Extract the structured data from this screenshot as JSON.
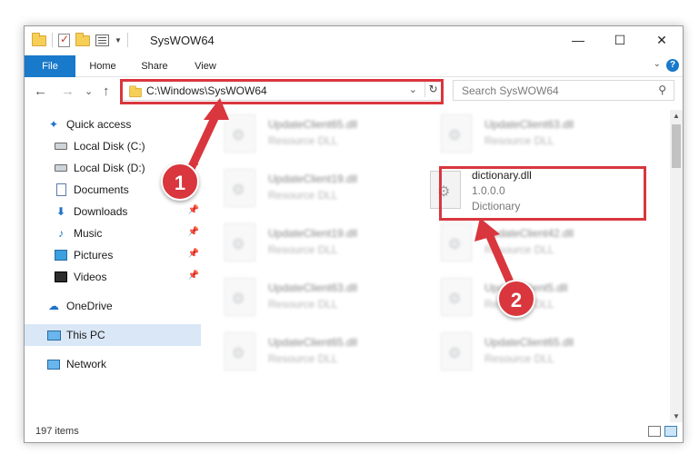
{
  "window": {
    "title": "SysWOW64"
  },
  "window_controls": {
    "minimize": "—",
    "maximize": "☐",
    "close": "✕"
  },
  "ribbon": {
    "tabs": [
      "File",
      "Home",
      "Share",
      "View"
    ],
    "help": "?"
  },
  "nav": {
    "back": "←",
    "forward": "→",
    "recent": "⌄",
    "up": "↑",
    "address_path": "C:\\Windows\\SysWOW64",
    "address_dropdown": "⌄",
    "refresh": "↻",
    "search_placeholder": "Search SysWOW64",
    "search_icon": "⚲"
  },
  "sidebar": {
    "items": [
      {
        "label": "Quick access",
        "icon": "star-icon",
        "pinned": false
      },
      {
        "label": "Local Disk (C:)",
        "icon": "drive-icon",
        "pinned": false
      },
      {
        "label": "Local Disk (D:)",
        "icon": "drive-icon",
        "pinned": true
      },
      {
        "label": "Documents",
        "icon": "documents-icon",
        "pinned": true
      },
      {
        "label": "Downloads",
        "icon": "downloads-icon",
        "pinned": true
      },
      {
        "label": "Music",
        "icon": "music-icon",
        "pinned": true
      },
      {
        "label": "Pictures",
        "icon": "pictures-icon",
        "pinned": true
      },
      {
        "label": "Videos",
        "icon": "videos-icon",
        "pinned": true
      },
      {
        "label": "OneDrive",
        "icon": "onedrive-icon",
        "pinned": false
      },
      {
        "label": "This PC",
        "icon": "this-pc-icon",
        "pinned": false,
        "selected": true
      },
      {
        "label": "Network",
        "icon": "network-icon",
        "pinned": false
      }
    ]
  },
  "files": [
    {
      "name": "UpdateClient65.dll",
      "desc": "Resource DLL",
      "col": 0,
      "row": 0
    },
    {
      "name": "UpdateClient63.dll",
      "desc": "Resource DLL",
      "col": 1,
      "row": 0
    },
    {
      "name": "UpdateClient19.dll",
      "desc": "Resource DLL",
      "col": 0,
      "row": 1
    },
    {
      "name": "UpdateClient19.dll",
      "desc": "Resource DLL",
      "col": 0,
      "row": 2
    },
    {
      "name": "UpdateClient42.dll",
      "desc": "Resource DLL",
      "col": 1,
      "row": 2
    },
    {
      "name": "UpdateClient63.dll",
      "desc": "Resource DLL",
      "col": 0,
      "row": 3
    },
    {
      "name": "UpdateClient5.dll",
      "desc": "Resource DLL",
      "col": 1,
      "row": 3
    },
    {
      "name": "UpdateClient65.dll",
      "desc": "Resource DLL",
      "col": 0,
      "row": 4
    },
    {
      "name": "UpdateClient65.dll",
      "desc": "Resource DLL",
      "col": 1,
      "row": 4
    }
  ],
  "highlighted_file": {
    "name": "dictionary.dll",
    "version": "1.0.0.0",
    "desc": "Dictionary"
  },
  "status": {
    "item_count": "197 items"
  },
  "annotations": {
    "step1": "1",
    "step2": "2",
    "highlight_color": "#d9363e"
  },
  "colors": {
    "accent": "#1979ca",
    "selected_nav": "#d9e7f6"
  }
}
